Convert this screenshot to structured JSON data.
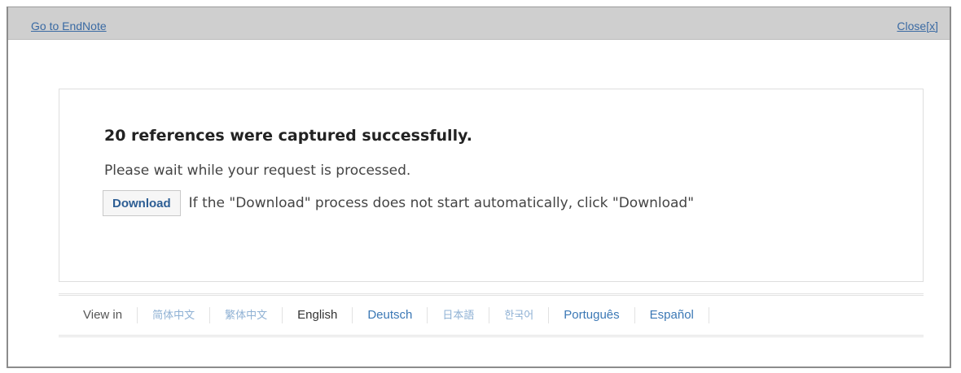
{
  "titlebar": {
    "goto_label": "Go to EndNote",
    "close_label": "Close[x]"
  },
  "message": {
    "headline": "20 references were captured successfully.",
    "wait_text": "Please wait while your request is processed.",
    "download_button": "Download",
    "download_hint": "If the \"Download\" process does not start automatically, click \"Download\""
  },
  "languages": {
    "view_in_label": "View in",
    "items": [
      {
        "label": "简体中文"
      },
      {
        "label": "繁体中文"
      },
      {
        "label": "English"
      },
      {
        "label": "Deutsch"
      },
      {
        "label": "日本語"
      },
      {
        "label": "한국어"
      },
      {
        "label": "Português"
      },
      {
        "label": "Español"
      }
    ],
    "current": "English"
  }
}
